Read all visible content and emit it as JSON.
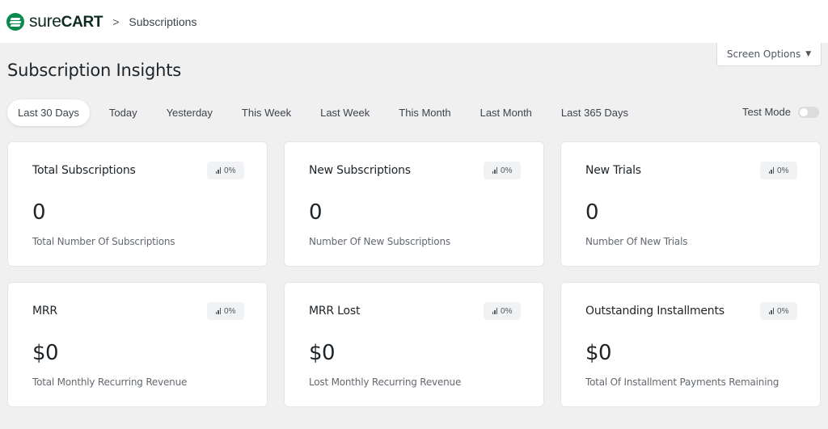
{
  "header": {
    "logo": {
      "text_light": "sure",
      "text_bold": "CART",
      "icon": "surecart-logo-icon",
      "brand_color": "#0b8a4e"
    },
    "breadcrumb_separator": ">",
    "breadcrumb": "Subscriptions"
  },
  "screen_options": {
    "label": "Screen Options",
    "caret": "▼"
  },
  "page": {
    "title": "Subscription Insights"
  },
  "tabs": [
    {
      "label": "Last 30 Days",
      "active": true
    },
    {
      "label": "Today",
      "active": false
    },
    {
      "label": "Yesterday",
      "active": false
    },
    {
      "label": "This Week",
      "active": false
    },
    {
      "label": "Last Week",
      "active": false
    },
    {
      "label": "This Month",
      "active": false
    },
    {
      "label": "Last Month",
      "active": false
    },
    {
      "label": "Last 365 Days",
      "active": false
    }
  ],
  "test_mode": {
    "label": "Test Mode",
    "enabled": false
  },
  "cards": [
    {
      "title": "Total Subscriptions",
      "change": "0%",
      "value": "0",
      "description": "Total Number Of Subscriptions"
    },
    {
      "title": "New Subscriptions",
      "change": "0%",
      "value": "0",
      "description": "Number Of New Subscriptions"
    },
    {
      "title": "New Trials",
      "change": "0%",
      "value": "0",
      "description": "Number Of New Trials"
    },
    {
      "title": "MRR",
      "change": "0%",
      "value": "$0",
      "description": "Total Monthly Recurring Revenue"
    },
    {
      "title": "MRR Lost",
      "change": "0%",
      "value": "$0",
      "description": "Lost Monthly Recurring Revenue"
    },
    {
      "title": "Outstanding Installments",
      "change": "0%",
      "value": "$0",
      "description": "Total Of Installment Payments Remaining"
    }
  ]
}
